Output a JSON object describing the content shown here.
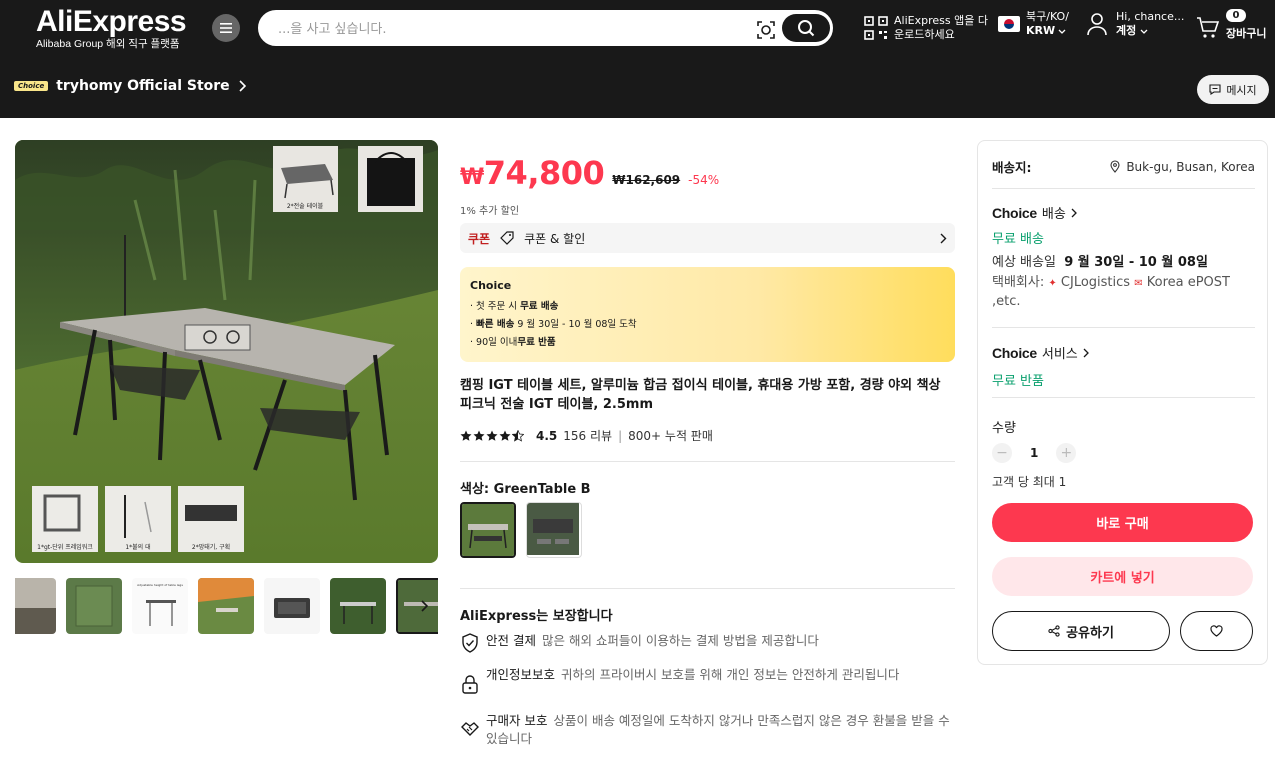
{
  "header": {
    "logo": "AliExpress",
    "logo_sub": "Alibaba Group 해외 직구 플랫폼",
    "search_placeholder": "...을 사고 싶습니다.",
    "app_download": "AliExpress 앱을 다운로드하세요",
    "lang_top": "북구/KO/",
    "lang_bottom": "KRW",
    "account_top": "Hi, chance...",
    "account_bottom": "계정",
    "cart_count": "0",
    "cart_label": "장바구니"
  },
  "store": {
    "choice_tag": "Choice",
    "name": "tryhomy Official Store",
    "message_button": "메시지"
  },
  "product": {
    "price_currency": "₩",
    "price": "74,800",
    "original_price": "₩162,609",
    "discount": "-54%",
    "extra_discount": "1% 추가 할인",
    "coupon_key": "쿠폰",
    "coupon_value": "쿠폰 & 할인",
    "choice_box": {
      "heading": "Choice",
      "lines": [
        {
          "pre": "· 첫 주문 시 ",
          "bold": "무료 배송",
          "post": ""
        },
        {
          "pre": "· ",
          "bold": "빠른 배송",
          "post": " 9 월 30일 - 10 월 08일 도착"
        },
        {
          "pre": "· 90일 이내",
          "bold": "무료 반품",
          "post": ""
        }
      ]
    },
    "title": "캠핑 IGT 테이블 세트, 알루미늄 합금 접이식 테이블, 휴대용 가방 포함, 경량 야외 책상 피크닉 전술 IGT 테이블, 2.5mm",
    "rating_score": "4.5",
    "review_count": "156 리뷰",
    "sold": "800+ 누적 판매",
    "color_label": "색상: GreenTable B",
    "main_image_labels": [
      "2*전술 테이블",
      "1*gt-단위 프레임워크",
      "1*불의 대",
      "2*망태기, 구획"
    ],
    "thumb_label": "Adjustable height of table legs"
  },
  "guarantee": {
    "heading": "AliExpress는 보장합니다",
    "items": [
      {
        "key": "안전 결제",
        "desc": "많은 해외 쇼퍼들이 이용하는 결제 방법을 제공합니다"
      },
      {
        "key": "개인정보보호",
        "desc": "귀하의 프라이버시 보호를 위해 개인 정보는 안전하게 관리됩니다"
      },
      {
        "key": "구매자 보호",
        "desc": "상품이 배송 예정일에 도착하지 않거나 만족스럽지 않은 경우 환불을 받을 수 있습니다"
      }
    ]
  },
  "sidebar": {
    "ship_to_label": "배송지:",
    "ship_to_value": "Buk-gu, Busan, Korea",
    "choice_brand": "Choice",
    "delivery_label": "배송",
    "free_shipping": "무료 배송",
    "est_label": "예상 배송일",
    "est_value": "9 월 30일 - 10 월 08일",
    "carrier_label": "택배회사:",
    "carrier_1": "CJLogistics",
    "carrier_2": "Korea ePOST ,etc.",
    "service_label": "서비스",
    "free_returns": "무료 반품",
    "qty_label": "수량",
    "qty_value": "1",
    "qty_max": "고객 당 최대 1",
    "buy_now": "바로 구매",
    "add_to_cart": "카트에 넣기",
    "share": "공유하기"
  },
  "colors": {
    "accent": "#fd384f",
    "header_bg": "#191919",
    "green": "#0aa06e"
  }
}
